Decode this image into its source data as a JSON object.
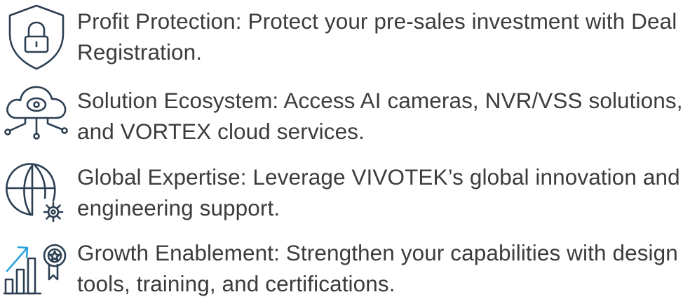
{
  "features": [
    {
      "icon": "shield-lock-icon",
      "text": "Profit Protection: Protect your pre-sales investment with Deal Registration."
    },
    {
      "icon": "cloud-network-icon",
      "text": "Solution Ecosystem: Access AI cameras, NVR/VSS solutions, and VORTEX cloud services."
    },
    {
      "icon": "globe-gear-icon",
      "text": "Global Expertise: Leverage VIVOTEK’s global innovation and engineering support."
    },
    {
      "icon": "growth-award-icon",
      "text": "Growth Enablement: Strengthen your capabilities with design tools, training, and certifications."
    }
  ],
  "colors": {
    "text": "#3c3c3c",
    "icon_stroke": "#2c3f52",
    "icon_accent": "#2aa3dc"
  }
}
